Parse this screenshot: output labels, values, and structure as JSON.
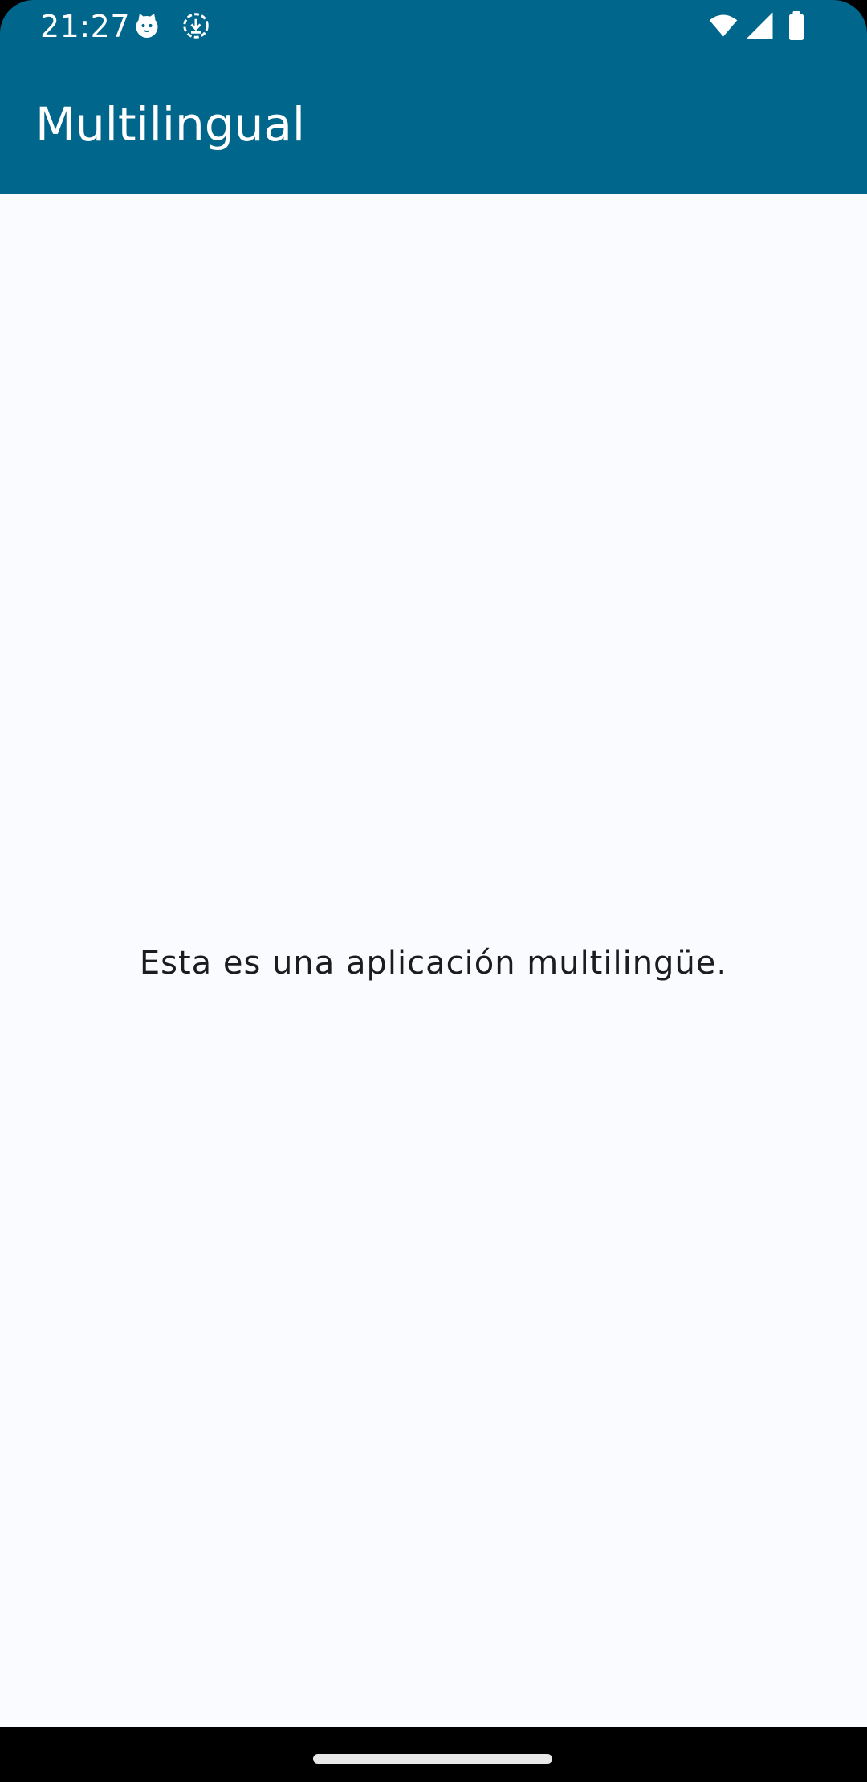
{
  "status_bar": {
    "time": "21:27",
    "icons": [
      "cat-face-icon",
      "download-progress-icon",
      "wifi-icon",
      "cellular-signal-icon",
      "battery-icon"
    ]
  },
  "app_bar": {
    "title": "Multilingual"
  },
  "content": {
    "message": "Esta es una aplicación multilingüe."
  },
  "colors": {
    "primary": "#00668b",
    "background": "#fafbfe",
    "text": "#1a1c1e",
    "on_primary": "#ffffff"
  }
}
